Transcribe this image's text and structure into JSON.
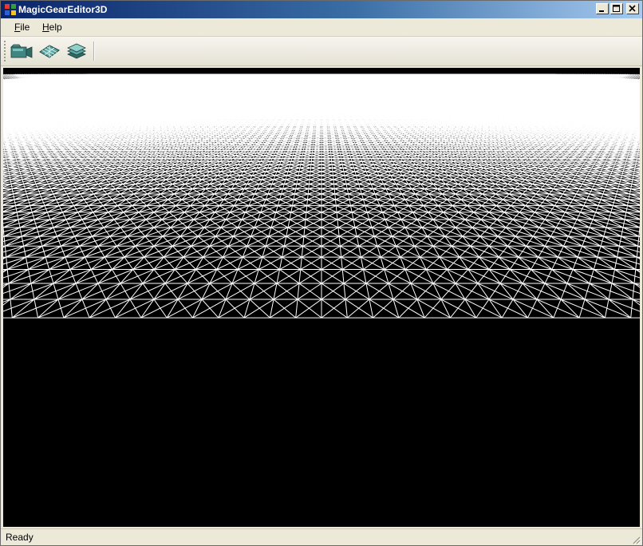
{
  "window": {
    "title": "MagicGearEditor3D"
  },
  "menu": {
    "file": {
      "label": "File",
      "accel": "F",
      "rest": "ile"
    },
    "help": {
      "label": "Help",
      "accel": "H",
      "rest": "elp"
    }
  },
  "toolbar": {
    "buttons": [
      {
        "icon": "camera-icon"
      },
      {
        "icon": "terrain-mesh-icon"
      },
      {
        "icon": "layers-icon"
      }
    ]
  },
  "viewport": {
    "background": "#000000",
    "grid_color": "#ffffff",
    "render_mode": "wireframe"
  },
  "status": {
    "text": "Ready"
  },
  "colors": {
    "titlebar_start": "#0a246a",
    "titlebar_end": "#a6caf0",
    "chrome": "#ece9d8"
  }
}
